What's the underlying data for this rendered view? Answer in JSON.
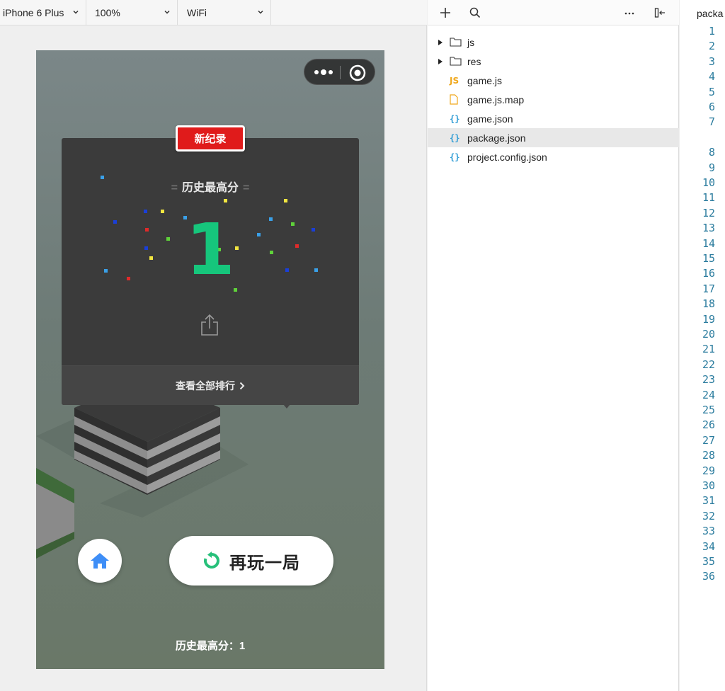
{
  "simulator": {
    "toolbar": {
      "device": "iPhone 6 Plus",
      "zoom": "100%",
      "network": "WiFi"
    },
    "game": {
      "record_badge": "新纪录",
      "high_score_title": "历史最高分",
      "high_score_value": "1",
      "rank_link_label": "查看全部排行",
      "replay_label": "再玩一局",
      "bottom_high_score": "历史最高分：1",
      "icons": [
        "more-icon",
        "close-circle-icon",
        "share-icon",
        "chevron-right-icon",
        "home-icon",
        "replay-icon"
      ]
    },
    "colors": {
      "badge": "#e01b1b",
      "score": "#16c67c",
      "card": "#3b3b3b",
      "home_icon": "#3e8ef7",
      "replay_icon": "#27c07a"
    }
  },
  "explorer": {
    "toolbar_icons": [
      "add-icon",
      "search-icon",
      "more-icon",
      "collapse-panel-icon"
    ],
    "tree": [
      {
        "name": "js",
        "type": "folder"
      },
      {
        "name": "res",
        "type": "folder"
      },
      {
        "name": "game.js",
        "type": "js"
      },
      {
        "name": "game.js.map",
        "type": "file"
      },
      {
        "name": "game.json",
        "type": "json"
      },
      {
        "name": "package.json",
        "type": "json",
        "selected": true
      },
      {
        "name": "project.config.json",
        "type": "json"
      }
    ]
  },
  "editor": {
    "tab_title": "packa",
    "line_numbers": [
      "1",
      "2",
      "3",
      "4",
      "5",
      "6",
      "7",
      "8",
      "9",
      "10",
      "11",
      "12",
      "13",
      "14",
      "15",
      "16",
      "17",
      "18",
      "19",
      "20",
      "21",
      "22",
      "23",
      "24",
      "25",
      "26",
      "27",
      "28",
      "29",
      "30",
      "31",
      "32",
      "33",
      "34",
      "35",
      "36"
    ]
  }
}
